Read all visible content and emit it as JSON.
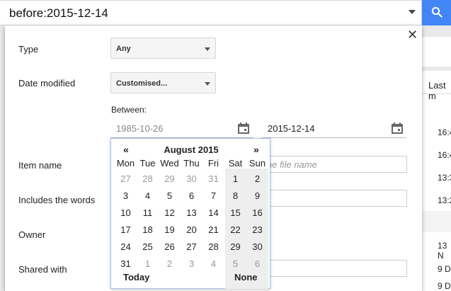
{
  "search": {
    "value": "before:2015-12-14"
  },
  "background": {
    "column_header": "Last m",
    "times": [
      "16:4",
      "16:4",
      "13:3",
      "13:2"
    ],
    "dates": [
      "13 N",
      "9 D",
      "9 D"
    ]
  },
  "panel": {
    "close_glyph": "✕",
    "type_label": "Type",
    "type_value": "Any",
    "date_modified_label": "Date modified",
    "date_modified_value": "Customised...",
    "between_label": "Between:",
    "date_from": "1985-10-26",
    "date_to": "2015-12-14",
    "item_name_label": "Item name",
    "item_name_placeholder": "ne file name",
    "includes_label": "Includes the words",
    "owner_label": "Owner",
    "shared_label": "Shared with"
  },
  "calendar": {
    "prev": "«",
    "next": "»",
    "month": "August 2015",
    "weekdays": [
      "Mon",
      "Tue",
      "Wed",
      "Thu",
      "Fri",
      "Sat",
      "Sun"
    ],
    "weeks": [
      [
        "27",
        "28",
        "29",
        "30",
        "31",
        "1",
        "2"
      ],
      [
        "3",
        "4",
        "5",
        "6",
        "7",
        "8",
        "9"
      ],
      [
        "10",
        "11",
        "12",
        "13",
        "14",
        "15",
        "16"
      ],
      [
        "17",
        "18",
        "19",
        "20",
        "21",
        "22",
        "23"
      ],
      [
        "24",
        "25",
        "26",
        "27",
        "28",
        "29",
        "30"
      ],
      [
        "31",
        "1",
        "2",
        "3",
        "4",
        "5",
        "6"
      ]
    ],
    "muted": [
      [
        true,
        true,
        true,
        true,
        true,
        false,
        false
      ],
      [
        false,
        false,
        false,
        false,
        false,
        false,
        false
      ],
      [
        false,
        false,
        false,
        false,
        false,
        false,
        false
      ],
      [
        false,
        false,
        false,
        false,
        false,
        false,
        false
      ],
      [
        false,
        false,
        false,
        false,
        false,
        false,
        false
      ],
      [
        false,
        true,
        true,
        true,
        true,
        true,
        true
      ]
    ],
    "today_label": "Today",
    "none_label": "None"
  },
  "colors": {
    "accent": "#4285f4"
  }
}
